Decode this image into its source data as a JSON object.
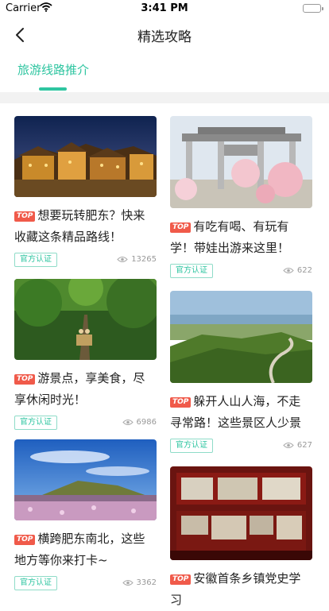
{
  "status": {
    "carrier": "Carrier",
    "time": "3:41 PM"
  },
  "nav": {
    "title": "精选攻略"
  },
  "tabs": [
    {
      "label": "旅游线路推介",
      "active": true
    }
  ],
  "badge": {
    "top_label": "TOP",
    "official_label": "官方认证"
  },
  "colors": {
    "accent": "#2ec5a0",
    "top_badge": "#f05a4a"
  },
  "cards": [
    {
      "title": "想要玩转肥东？快来收藏这条精品路线！",
      "views": "13265"
    },
    {
      "title": "有吃有喝、有玩有学！带娃出游来这里！",
      "views": "622"
    },
    {
      "title": "游景点，享美食，尽享休闲时光！",
      "views": "6986"
    },
    {
      "title": "躲开人山人海，不走寻常路！这些景区人少景美",
      "views": "627"
    },
    {
      "title": "横跨肥东南北，这些地方等你来打卡~",
      "views": "3362"
    },
    {
      "title": "安徽首条乡镇党史学习",
      "views": ""
    }
  ]
}
